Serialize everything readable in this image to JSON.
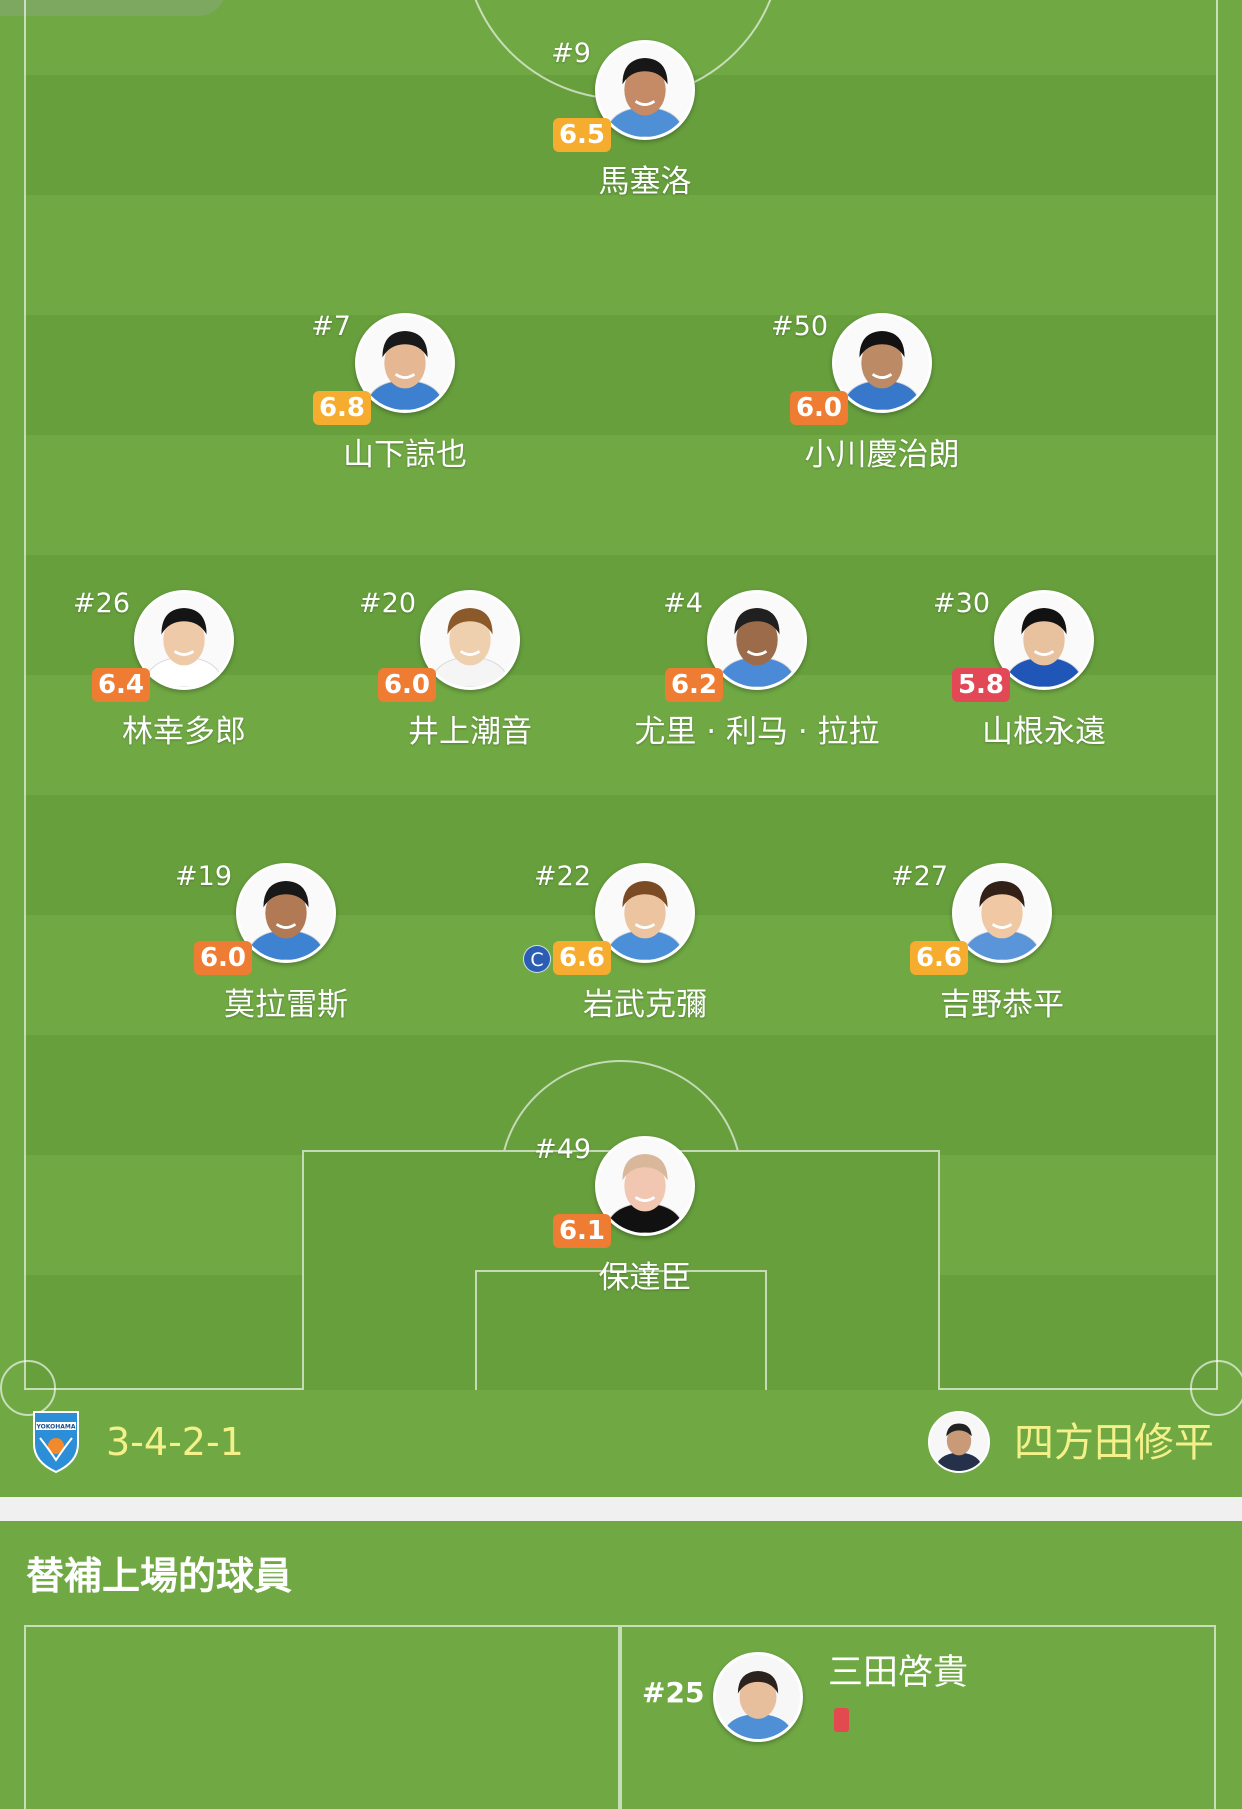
{
  "colors": {
    "pitch": "#70a944",
    "pitch_stripe": "#679f3d",
    "rating_high": "#f5ac2f",
    "rating_mid": "#ee7d33",
    "rating_low": "#e24856",
    "highlight_text": "#f4f08a",
    "red_card": "#e34a4f"
  },
  "team": {
    "logo_icon": "yokohama-fc-crest",
    "formation": "3-4-2-1",
    "coach": {
      "name": "四方田修平",
      "avatar_icon": "coach-photo"
    }
  },
  "players": [
    {
      "number": "#9",
      "name": "馬塞洛",
      "rating": "6.5",
      "rating_level": "high",
      "captain": false
    },
    {
      "number": "#7",
      "name": "山下諒也",
      "rating": "6.8",
      "rating_level": "high",
      "captain": false
    },
    {
      "number": "#50",
      "name": "小川慶治朗",
      "rating": "6.0",
      "rating_level": "mid",
      "captain": false
    },
    {
      "number": "#26",
      "name": "林幸多郎",
      "rating": "6.4",
      "rating_level": "mid",
      "captain": false
    },
    {
      "number": "#20",
      "name": "井上潮音",
      "rating": "6.0",
      "rating_level": "mid",
      "captain": false
    },
    {
      "number": "#4",
      "name": "尤里 · 利马 · 拉拉",
      "rating": "6.2",
      "rating_level": "mid",
      "captain": false
    },
    {
      "number": "#30",
      "name": "山根永遠",
      "rating": "5.8",
      "rating_level": "low",
      "captain": false
    },
    {
      "number": "#19",
      "name": "莫拉雷斯",
      "rating": "6.0",
      "rating_level": "mid",
      "captain": false
    },
    {
      "number": "#22",
      "name": "岩武克彌",
      "rating": "6.6",
      "rating_level": "high",
      "captain": true,
      "captain_label": "C"
    },
    {
      "number": "#27",
      "name": "吉野恭平",
      "rating": "6.6",
      "rating_level": "high",
      "captain": false
    },
    {
      "number": "#49",
      "name": "保達臣",
      "rating": "6.1",
      "rating_level": "mid",
      "captain": false
    }
  ],
  "substitutes": {
    "title": "替補上場的球員",
    "players": [
      {
        "number": "#25",
        "name": "三田啓貴",
        "card": "red-card-icon"
      }
    ]
  }
}
